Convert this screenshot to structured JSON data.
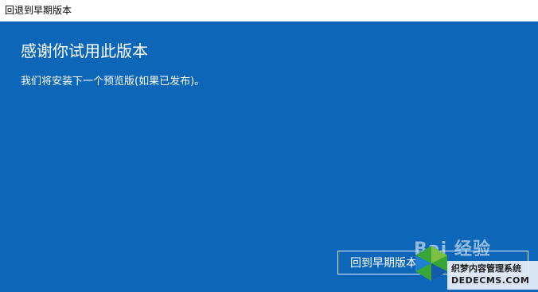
{
  "window": {
    "title": "回退到早期版本"
  },
  "main": {
    "heading": "感谢你试用此版本",
    "message": "我们将安装下一个预览版(如果已发布)。",
    "rollback_button_label": "回到早期版本"
  },
  "watermark": {
    "baidu_text": "Bai 经验",
    "site_cn": "织梦内容管理系统",
    "site_en": "DEDECMS.COM"
  },
  "colors": {
    "panel_background": "#0d66b8",
    "titlebar_background": "#ffffff",
    "text": "#ffffff"
  },
  "icons": {
    "watermark_logo": "dedecms-logo-icon"
  }
}
